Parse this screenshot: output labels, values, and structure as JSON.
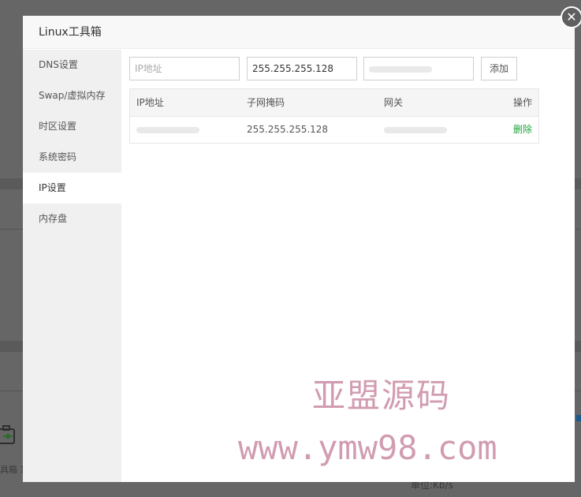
{
  "dialog": {
    "title": "Linux工具箱",
    "close_glyph": "✕"
  },
  "sidebar": {
    "items": [
      {
        "label": "DNS设置",
        "active": false
      },
      {
        "label": "Swap/虚拟内存",
        "active": false
      },
      {
        "label": "时区设置",
        "active": false
      },
      {
        "label": "系统密码",
        "active": false
      },
      {
        "label": "IP设置",
        "active": true
      },
      {
        "label": "内存盘",
        "active": false
      }
    ]
  },
  "ip_form": {
    "ip_placeholder": "IP地址",
    "netmask_value": "255.255.255.128",
    "gateway_value": "",
    "add_label": "添加"
  },
  "table": {
    "headers": {
      "ip": "IP地址",
      "netmask": "子网掩码",
      "gateway": "网关",
      "action": "操作"
    },
    "rows": [
      {
        "netmask": "255.255.255.128",
        "action": "删除"
      }
    ]
  },
  "background": {
    "toolbox_label": "具箱 1",
    "unit_label": "单位:Kb/s"
  },
  "watermark": {
    "line1": "亚盟源码",
    "line2": "www.ymw98.com"
  }
}
